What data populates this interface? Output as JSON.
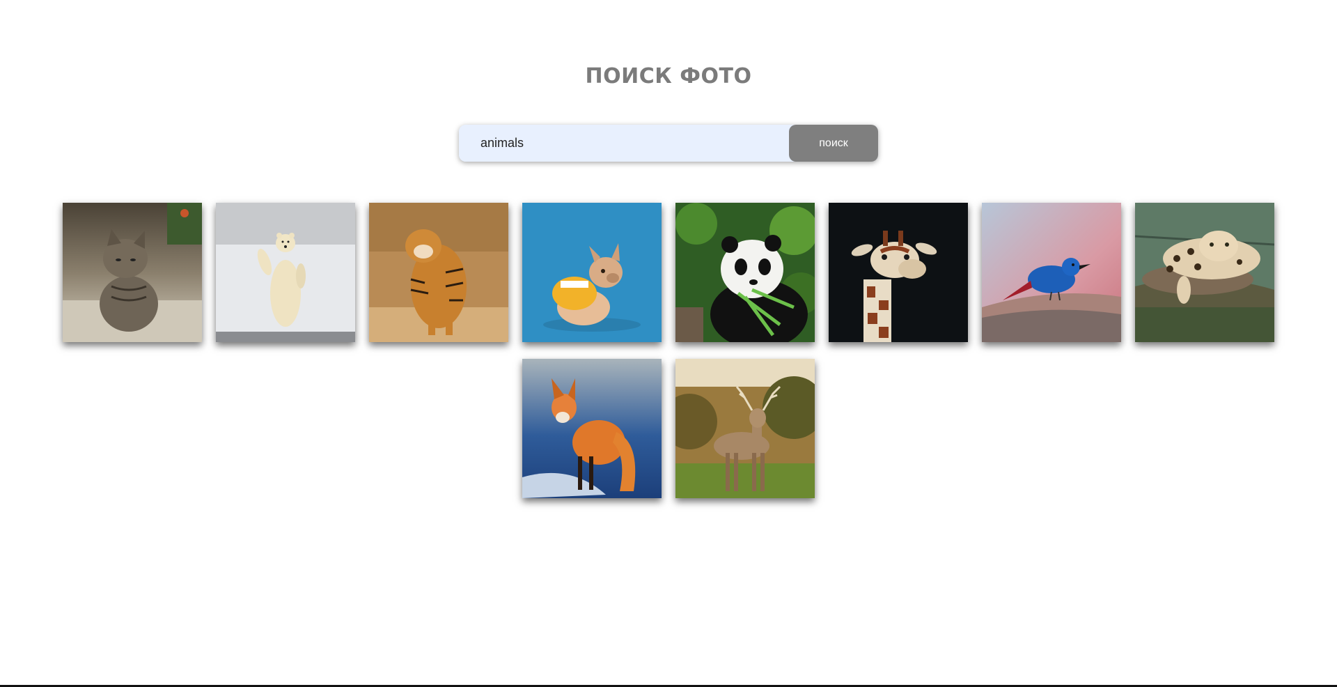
{
  "header": {
    "title": "ПОИСК ФОТО"
  },
  "search": {
    "value": "animals",
    "button_label": "поиск"
  },
  "gallery": {
    "photos": [
      {
        "subject": "kitten"
      },
      {
        "subject": "polar bear"
      },
      {
        "subject": "tiger"
      },
      {
        "subject": "french bulldog"
      },
      {
        "subject": "panda"
      },
      {
        "subject": "giraffe"
      },
      {
        "subject": "blue bird"
      },
      {
        "subject": "leopard"
      },
      {
        "subject": "fox"
      },
      {
        "subject": "deer"
      }
    ]
  },
  "colors": {
    "title": "#7b7b7b",
    "button": "#7f7f7f",
    "input_bg": "#e8f0fe"
  }
}
